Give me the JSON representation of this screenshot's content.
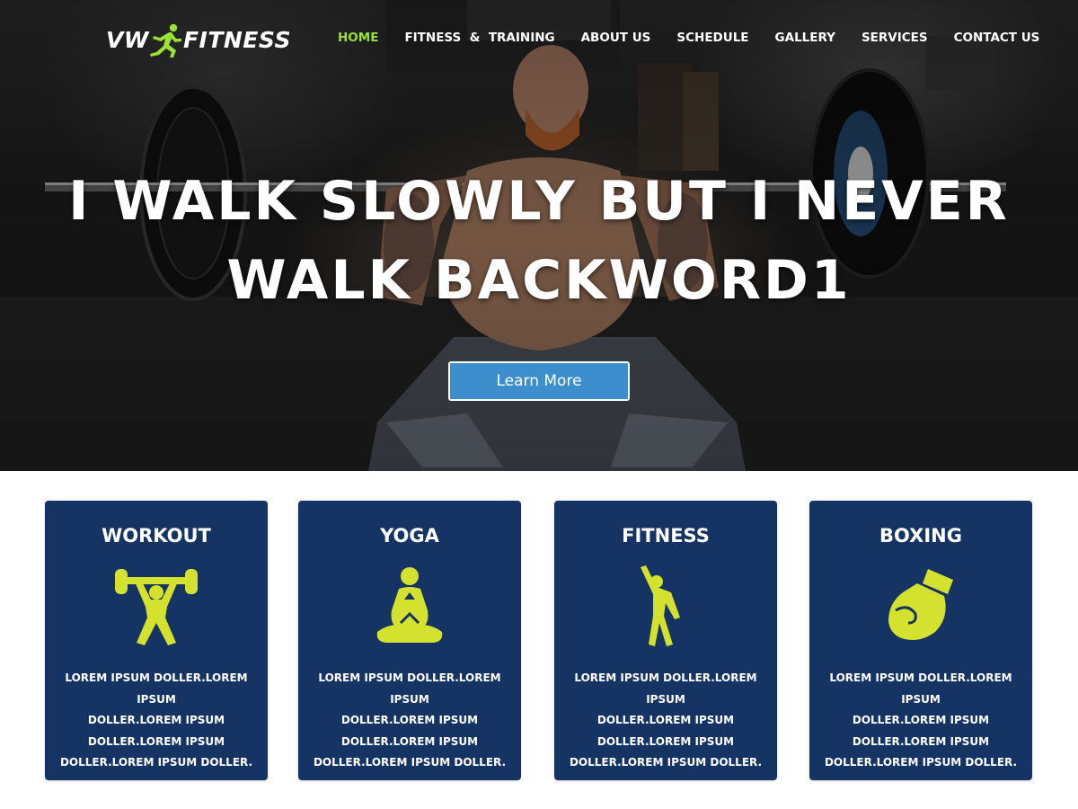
{
  "header": {
    "logo_text_left": "VW",
    "logo_text_right": "FITNESS",
    "nav": [
      {
        "label": "HOME",
        "active": true
      },
      {
        "label": "FITNESS  &  TRAINING",
        "active": false
      },
      {
        "label": "ABOUT US",
        "active": false
      },
      {
        "label": "SCHEDULE",
        "active": false
      },
      {
        "label": "GALLERY",
        "active": false
      },
      {
        "label": "SERVICES",
        "active": false
      },
      {
        "label": "CONTACT US",
        "active": false
      }
    ]
  },
  "hero": {
    "title_line1": "I WALK SLOWLY BUT I NEVER",
    "title_line2": "WALK BACKWORD1",
    "button_label": "Learn More"
  },
  "cards": [
    {
      "title": "WORKOUT",
      "icon": "weightlifter-icon",
      "lines": [
        "LOREM IPSUM DOLLER.LOREM IPSUM",
        "DOLLER.LOREM IPSUM",
        "DOLLER.LOREM IPSUM",
        "DOLLER.LOREM IPSUM DOLLER."
      ]
    },
    {
      "title": "YOGA",
      "icon": "yoga-meditation-icon",
      "lines": [
        "LOREM IPSUM DOLLER.LOREM IPSUM",
        "DOLLER.LOREM IPSUM",
        "DOLLER.LOREM IPSUM",
        "DOLLER.LOREM IPSUM DOLLER."
      ]
    },
    {
      "title": "FITNESS",
      "icon": "stretching-person-icon",
      "lines": [
        "LOREM IPSUM DOLLER.LOREM IPSUM",
        "DOLLER.LOREM IPSUM",
        "DOLLER.LOREM IPSUM",
        "DOLLER.LOREM IPSUM DOLLER."
      ]
    },
    {
      "title": "BOXING",
      "icon": "boxing-glove-icon",
      "lines": [
        "LOREM IPSUM DOLLER.LOREM IPSUM",
        "DOLLER.LOREM IPSUM",
        "DOLLER.LOREM IPSUM",
        "DOLLER.LOREM IPSUM DOLLER."
      ]
    }
  ],
  "colors": {
    "accent_green": "#9be034",
    "icon_yellow": "#d5e12f",
    "card_blue": "#163463",
    "button_blue": "#3d8ecd"
  }
}
